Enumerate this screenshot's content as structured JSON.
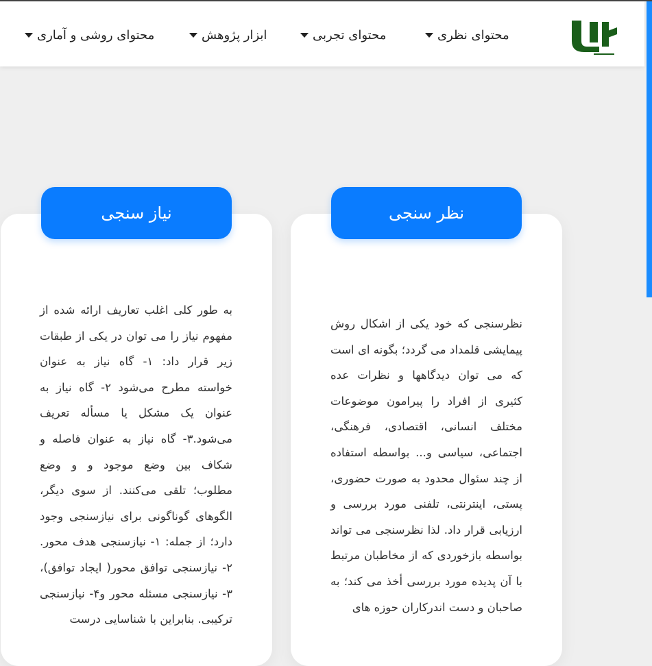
{
  "nav": {
    "items": [
      {
        "label": "محتوای نظری"
      },
      {
        "label": "محتوای تجربی"
      },
      {
        "label": "ابزار پژوهش"
      },
      {
        "label": "محتوای روشی و آماری"
      }
    ]
  },
  "logo": {
    "icon": "site-logo-icon",
    "color": "#1a5e1a"
  },
  "cards": [
    {
      "title": "نظر سنجی",
      "text": "نظرسنجی که خود یکی از اشکال روش پیمایشی قلمداد می گردد؛ بگونه ای است که می توان دیدگاهها و نظرات عده کثیری از افراد را پیرامون موضوعات مختلف انسانی، اقتصادی، فرهنگی، اجتماعی، سیاسی و... بواسطه استفاده از چند سئوال محدود به صورت حضوری، پستی، اینترنتی، تلفنی مورد بررسی و ارزیابی قرار داد. لذا نظرسنجی می تواند بواسطه بازخوردی که از مخاطبان مرتبط با آن پدیده مورد بررسی أخذ می کند؛ به صاحبان و دست اندرکاران حوزه های"
    },
    {
      "title": "نیاز سنجی",
      "text": "به طور کلی اغلب تعاریف ارائه شده از مفهوم نیاز را می توان در یکی از طبقات زیر قرار داد: ۱- گاه نیاز به عنوان خواسته مطرح می‌شود ۲- گاه نیاز به عنوان یک مشکل یا مسأله تعریف می‌شود.۳- گاه نیاز به عنوان فاصله و شکاف بین وضع موجود و و وضع مطلوب؛ تلقی می‌کنند. از سوی دیگر، الگوهای گوناگونی برای نیازسنجی وجود دارد؛ از جمله: ۱- نیازسنجی هدف محور. ۲- نیازسنجی توافق محور( ایجاد توافق)، ۳- نیازسنجی مسئله محور و۴- نیازسنجی ترکیبی. بنابراین با شناسایی درست"
    }
  ],
  "colors": {
    "accent": "#0a7cff",
    "background": "#efefef",
    "logo": "#1a5e1a"
  }
}
